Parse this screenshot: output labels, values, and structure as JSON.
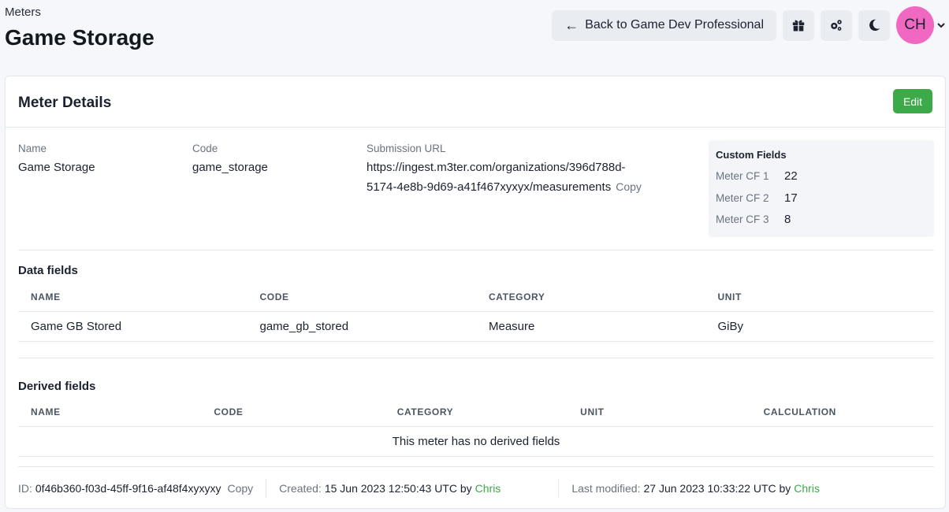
{
  "header": {
    "breadcrumb": "Meters",
    "title": "Game Storage",
    "back_label": "Back to Game Dev Professional",
    "avatar_initials": "CH",
    "icons": [
      "arrow-left-icon",
      "gift-icon",
      "gears-icon",
      "moon-icon",
      "chevron-down-icon"
    ]
  },
  "card": {
    "title": "Meter Details",
    "edit_label": "Edit"
  },
  "details": {
    "name_label": "Name",
    "name_value": "Game Storage",
    "code_label": "Code",
    "code_value": "game_storage",
    "url_label": "Submission URL",
    "url_line1": "https://ingest.m3ter.com/organizations/396d788d-",
    "url_line2": "5174-4e8b-9d69-a41f467xyxyx/measurements",
    "copy_label": "Copy"
  },
  "custom_fields": {
    "title": "Custom Fields",
    "rows": [
      {
        "key": "Meter CF 1",
        "value": "22"
      },
      {
        "key": "Meter CF 2",
        "value": "17"
      },
      {
        "key": "Meter CF 3",
        "value": "8"
      }
    ]
  },
  "data_fields": {
    "title": "Data fields",
    "headers": [
      "NAME",
      "CODE",
      "CATEGORY",
      "UNIT"
    ],
    "rows": [
      {
        "name": "Game GB Stored",
        "code": "game_gb_stored",
        "category": "Measure",
        "unit": "GiBy"
      }
    ]
  },
  "derived_fields": {
    "title": "Derived fields",
    "headers": [
      "NAME",
      "CODE",
      "CATEGORY",
      "UNIT",
      "CALCULATION"
    ],
    "empty_message": "This meter has no derived fields"
  },
  "footer": {
    "id_label": "ID:",
    "id_value": "0f46b360-f03d-45ff-9f16-af48f4xyxyxy",
    "copy_label": "Copy",
    "created_label": "Created:",
    "created_value": "15 Jun 2023 12:50:43 UTC by",
    "created_by": "Chris",
    "modified_label": "Last modified:",
    "modified_value": "27 Jun 2023 10:33:22 UTC by",
    "modified_by": "Chris"
  },
  "colors": {
    "accent_green": "#3daa49",
    "avatar_pink": "#f068c1",
    "background": "#f5f7fb"
  }
}
